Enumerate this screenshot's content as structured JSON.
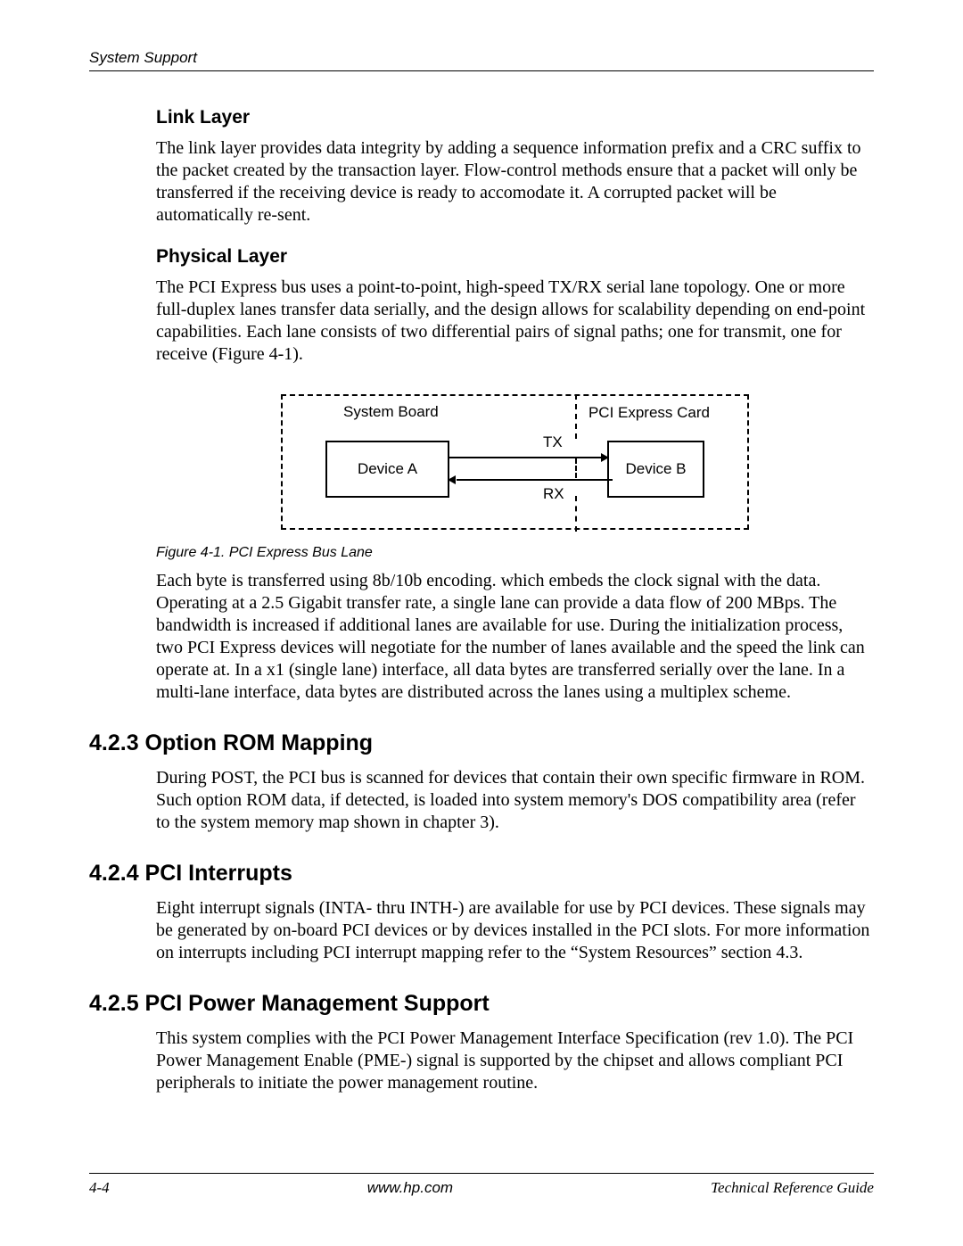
{
  "header": {
    "section": "System Support"
  },
  "linkLayer": {
    "heading": "Link Layer",
    "body": "The link layer provides data integrity by adding a sequence information prefix and a CRC suffix to the packet created by the transaction layer. Flow-control methods ensure that a packet will only be transferred if the receiving device is ready to accomodate it. A corrupted packet will be automatically re-sent."
  },
  "physicalLayer": {
    "heading": "Physical Layer",
    "body1": "The PCI Express bus uses a point-to-point, high-speed TX/RX serial lane topology. One or more full-duplex lanes transfer data serially, and the design allows for scalability depending on end-point capabilities. Each lane consists of two differential pairs of signal paths; one for transmit, one for receive (Figure 4-1).",
    "body2": "Each byte is transferred using 8b/10b encoding. which embeds the clock signal with the data. Operating at a 2.5 Gigabit transfer rate, a single lane can provide a data flow of 200 MBps. The bandwidth is increased if additional lanes are available for use. During the initialization process, two PCI Express devices will negotiate for the number of lanes available and the speed the link can operate at. In a x1 (single lane) interface, all data bytes are transferred serially over the lane. In a multi-lane interface, data bytes are distributed across the lanes using a multiplex scheme."
  },
  "figure": {
    "caption": "Figure 4-1. PCI Express Bus Lane",
    "systemBoard": "System Board",
    "pciCard": "PCI Express Card",
    "deviceA": "Device A",
    "deviceB": "Device B",
    "tx": "TX",
    "rx": "RX"
  },
  "optionRom": {
    "heading": "4.2.3 Option ROM Mapping",
    "body": "During POST,  the PCI bus is scanned for devices that contain their own specific firmware in ROM. Such option ROM data, if detected, is loaded into system memory's DOS compatibility area (refer to the system memory map shown in chapter 3)."
  },
  "pciInterrupts": {
    "heading": "4.2.4 PCI Interrupts",
    "body": "Eight interrupt signals (INTA- thru INTH-) are available for use by PCI devices. These signals may be generated by on-board PCI devices or by devices installed in the PCI slots. For more information on interrupts including PCI interrupt mapping refer to the “System Resources” section 4.3."
  },
  "pciPower": {
    "heading": "4.2.5 PCI Power Management Support",
    "body": "This system complies with the PCI Power Management Interface Specification (rev 1.0). The PCI Power Management Enable (PME-) signal is supported by the chipset and allows compliant PCI peripherals to initiate the power management routine."
  },
  "footer": {
    "pageNumber": "4-4",
    "url": "www.hp.com",
    "guide": "Technical Reference Guide"
  }
}
